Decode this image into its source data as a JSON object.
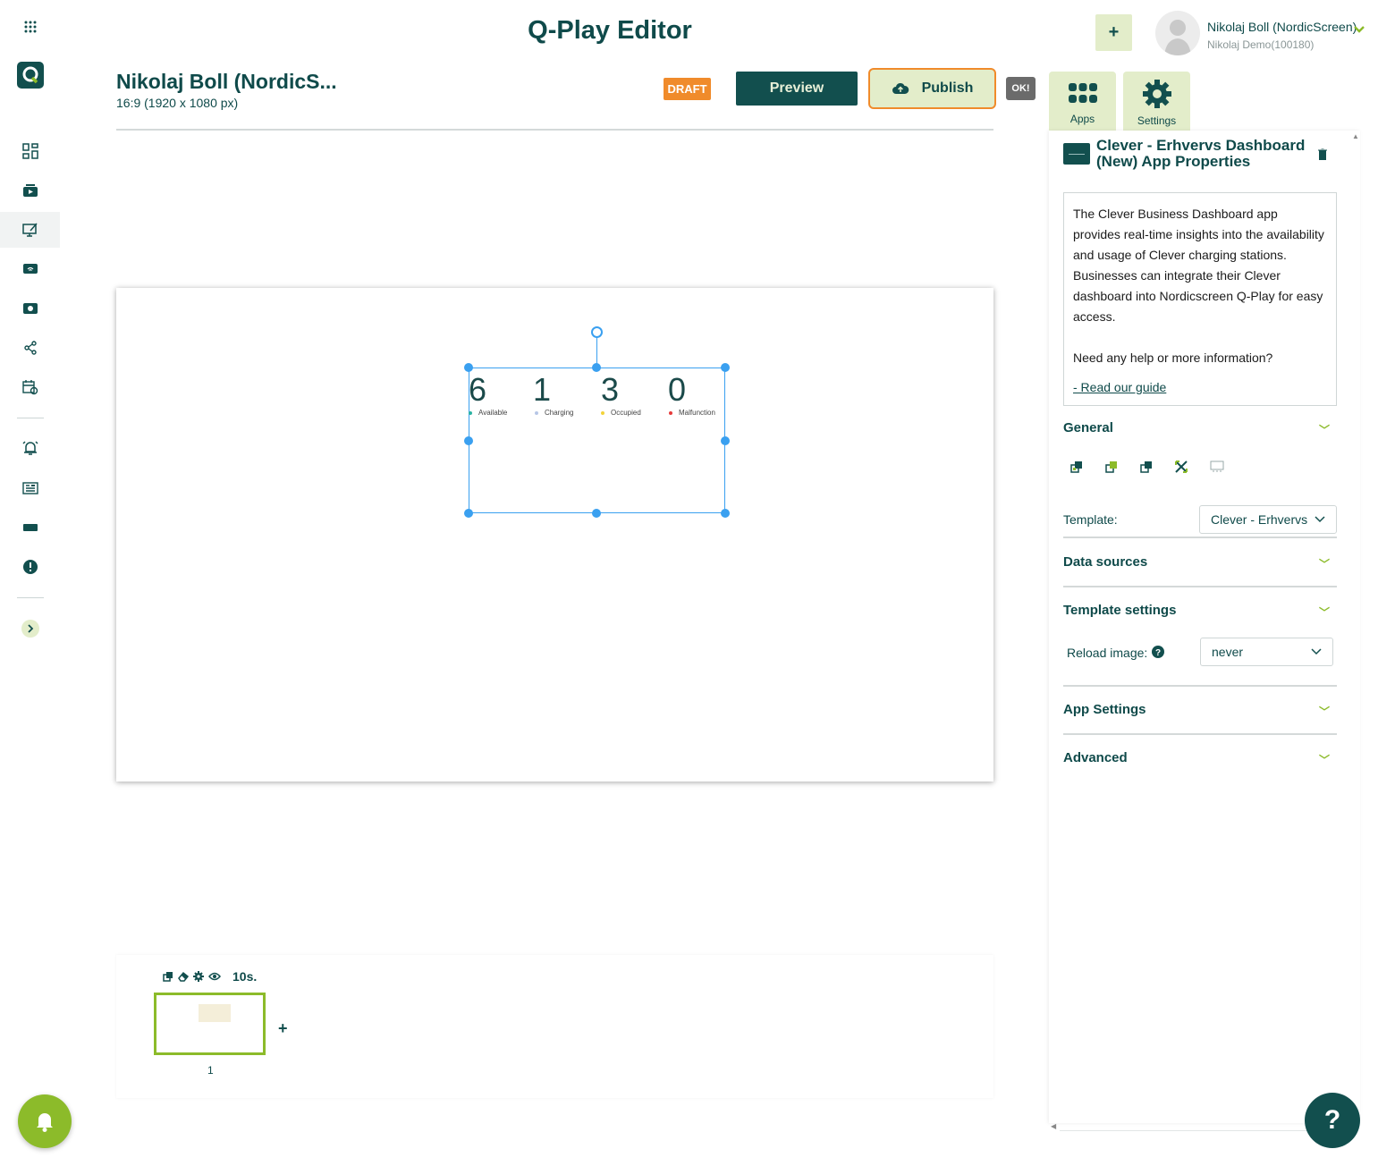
{
  "app": {
    "title": "Q-Play Editor"
  },
  "user": {
    "name": "Nikolaj Boll (NordicScreen)",
    "account": "Nikolaj Demo(100180)"
  },
  "document": {
    "title": "Nikolaj Boll (NordicS...",
    "resolution": "16:9 (1920 x 1080 px)"
  },
  "toolbar": {
    "status_badge": "DRAFT",
    "preview_label": "Preview",
    "publish_label": "Publish",
    "ok_badge": "OK!",
    "add_label": "+"
  },
  "panel_tabs": [
    {
      "label": "Apps"
    },
    {
      "label": "Settings"
    }
  ],
  "properties": {
    "title": "Clever - Erhvervs Dashboard (New) App Properties",
    "description": "The Clever Business Dashboard app provides real-time insights into the availability and usage of Clever charging stations. Businesses can integrate their Clever dashboard into Nordicscreen Q-Play for easy access.",
    "help_prompt": "Need any help or more information?",
    "guide_link": "- Read our guide",
    "sections": {
      "general": "General",
      "data_sources": "Data sources",
      "template_settings": "Template settings",
      "app_settings": "App Settings",
      "advanced": "Advanced"
    },
    "template_label": "Template:",
    "template_value": "Clever - Erhvervs",
    "reload_label": "Reload image:",
    "reload_value": "never"
  },
  "widget": {
    "stats": [
      {
        "value": "6",
        "label": "Available",
        "color": "#2ab3a3"
      },
      {
        "value": "1",
        "label": "Charging",
        "color": "#b7c6e6"
      },
      {
        "value": "3",
        "label": "Occupied",
        "color": "#f2d33a"
      },
      {
        "value": "0",
        "label": "Malfunction",
        "color": "#e63b3b"
      }
    ]
  },
  "timeline": {
    "duration": "10s.",
    "slide_number": "1",
    "add_label": "+"
  },
  "colors": {
    "primary": "#124f4e",
    "accent": "#8cbb2a",
    "highlight": "#f08b2b",
    "light": "#e3edca"
  },
  "icons": [
    "apps-grid-icon",
    "logo-icon",
    "dashboard-icon",
    "media-icon",
    "editor-icon",
    "screens-icon",
    "playlist-icon",
    "share-icon",
    "schedule-icon",
    "alarm-icon",
    "news-icon",
    "ticker-icon",
    "alert-icon",
    "expand-icon",
    "cloud-upload-icon",
    "gear-icon",
    "trash-icon",
    "bell-icon",
    "help-icon"
  ]
}
